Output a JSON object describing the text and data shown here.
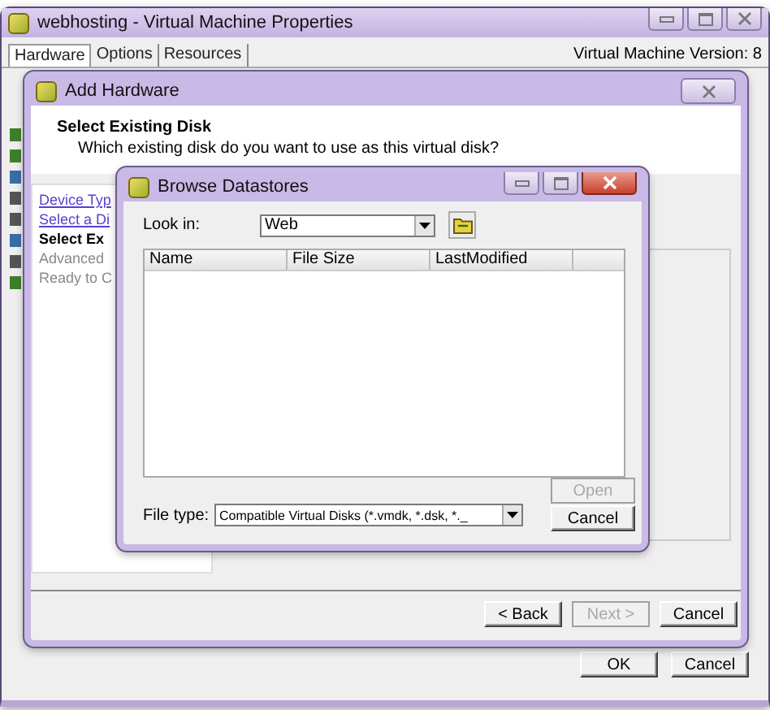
{
  "window": {
    "title": "webhosting - Virtual Machine Properties",
    "version": "Virtual Machine Version: 8"
  },
  "tabs": [
    {
      "label": "Hardware",
      "selected": true
    },
    {
      "label": "Options",
      "selected": false
    },
    {
      "label": "Resources",
      "selected": false
    }
  ],
  "wizard": {
    "title": "Add Hardware",
    "heading": "Select Existing Disk",
    "subtitle": "Which existing disk do you want to use as this virtual disk?",
    "steps": [
      {
        "label": "Device Typ",
        "kind": "link"
      },
      {
        "label": "Select a Di",
        "kind": "link"
      },
      {
        "label": "Select Ex",
        "kind": "current"
      },
      {
        "label": "Advanced",
        "kind": "pending"
      },
      {
        "label": "Ready to C",
        "kind": "pending"
      }
    ],
    "buttons": [
      {
        "label": "< Back",
        "disabled": false
      },
      {
        "label": "Next >",
        "disabled": true
      },
      {
        "label": "Cancel",
        "disabled": false
      }
    ]
  },
  "browse": {
    "title": "Browse Datastores",
    "look_in_label": "Look in:",
    "look_in": "Web",
    "columns": [
      "Name",
      "File Size",
      "LastModified"
    ],
    "file_type_label": "File type:",
    "file_type": "Compatible Virtual Disks (*.vmdk, *.dsk, *._",
    "buttons": [
      {
        "label": "Open",
        "disabled": true
      },
      {
        "label": "Cancel",
        "disabled": false
      }
    ]
  },
  "buttons": [
    {
      "label": "OK",
      "disabled": false
    },
    {
      "label": "Cancel",
      "disabled": false
    }
  ]
}
